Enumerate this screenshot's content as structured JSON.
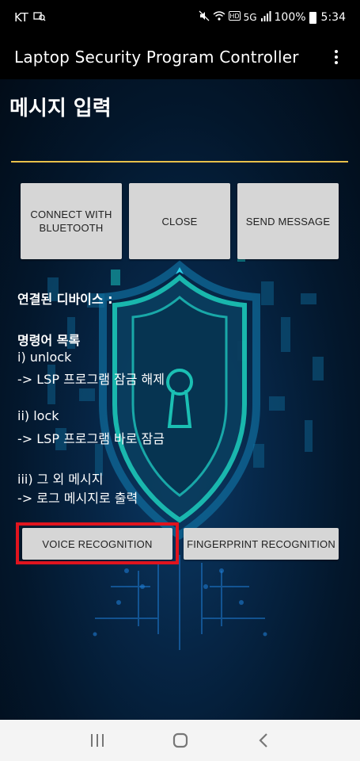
{
  "status_bar": {
    "carrier": "KT",
    "battery": "100%",
    "time": "5:34",
    "network": "5G"
  },
  "app_bar": {
    "title": "Laptop Security Program Controller"
  },
  "main": {
    "input_label": "메시지 입력",
    "buttons": {
      "connect": "CONNECT WITH BLUETOOTH",
      "close": "CLOSE",
      "send": "SEND MESSAGE",
      "voice": "VOICE RECOGNITION",
      "fingerprint": "FINGERPRINT RECOGNITION"
    },
    "connected_device_label": "연결된 디바이스 :",
    "commands_title": "명령어 목록",
    "commands": [
      {
        "name": "i) unlock",
        "desc": "-> LSP 프로그램 잠금 해제"
      },
      {
        "name": "ii) lock",
        "desc": "-> LSP 프로그램 바로 잠금"
      },
      {
        "name": "iii) 그 외 메시지",
        "desc": "-> 로그 메시지로 출력"
      }
    ]
  },
  "colors": {
    "accent_line": "#e8c04a",
    "highlight": "#e0141e",
    "button_bg": "#d6d6d6"
  }
}
